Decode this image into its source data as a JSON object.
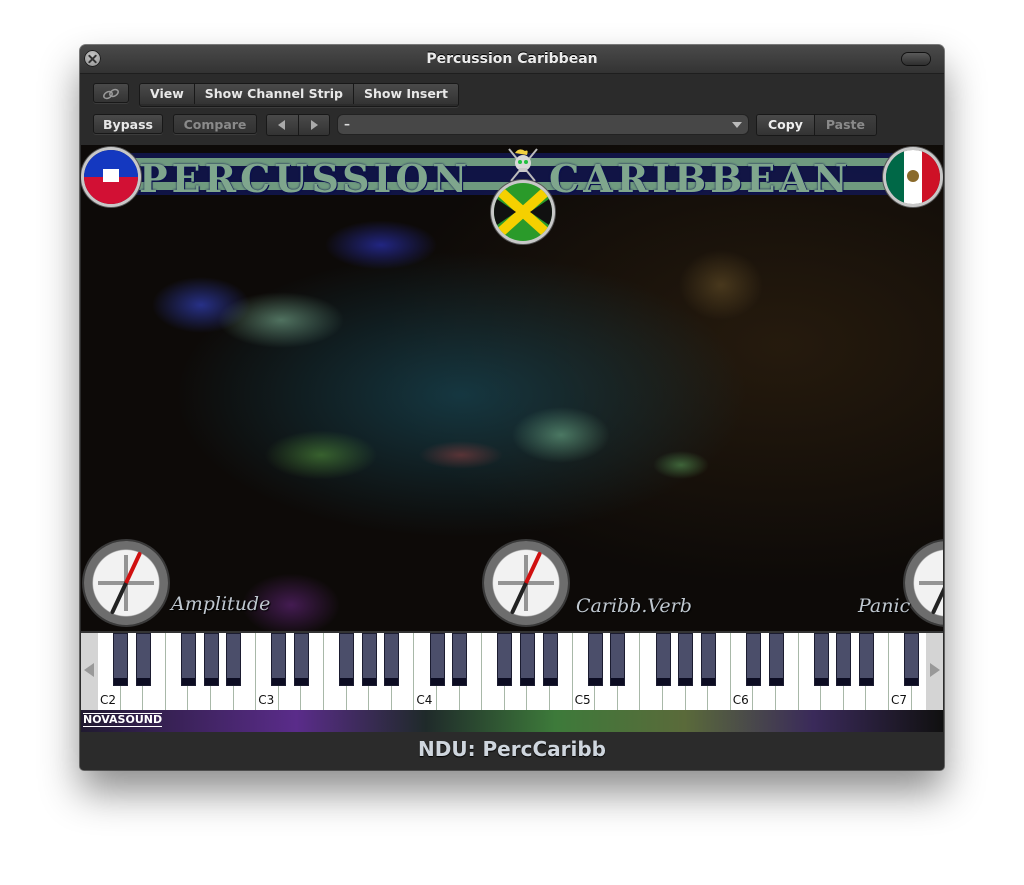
{
  "window": {
    "title": "Percussion Caribbean"
  },
  "toolbar": {
    "link_icon": "chain-link-icon",
    "view_label": "View",
    "show_channel_strip_label": "Show Channel Strip",
    "show_insert_label": "Show Insert",
    "bypass_label": "Bypass",
    "compare_label": "Compare",
    "prev_icon": "triangle-left-icon",
    "next_icon": "triangle-right-icon",
    "preset_value": "–",
    "copy_label": "Copy",
    "paste_label": "Paste"
  },
  "plugin": {
    "banner_left": "PERCUSSION",
    "banner_right": "CARIBBEAN",
    "flags": [
      "haiti",
      "jamaica",
      "mexico"
    ],
    "knobs": [
      {
        "label": "Amplitude"
      },
      {
        "label": "Caribb.Verb"
      },
      {
        "label": "Panic"
      }
    ],
    "keyboard": {
      "octave_labels": [
        "C2",
        "C3",
        "C4",
        "C5",
        "C6",
        "C7"
      ],
      "scroll_left_icon": "triangle-left-icon",
      "scroll_right_icon": "triangle-right-icon"
    },
    "brand": "NOVASOUND"
  },
  "footer": {
    "text": "NDU: PercCaribb"
  }
}
